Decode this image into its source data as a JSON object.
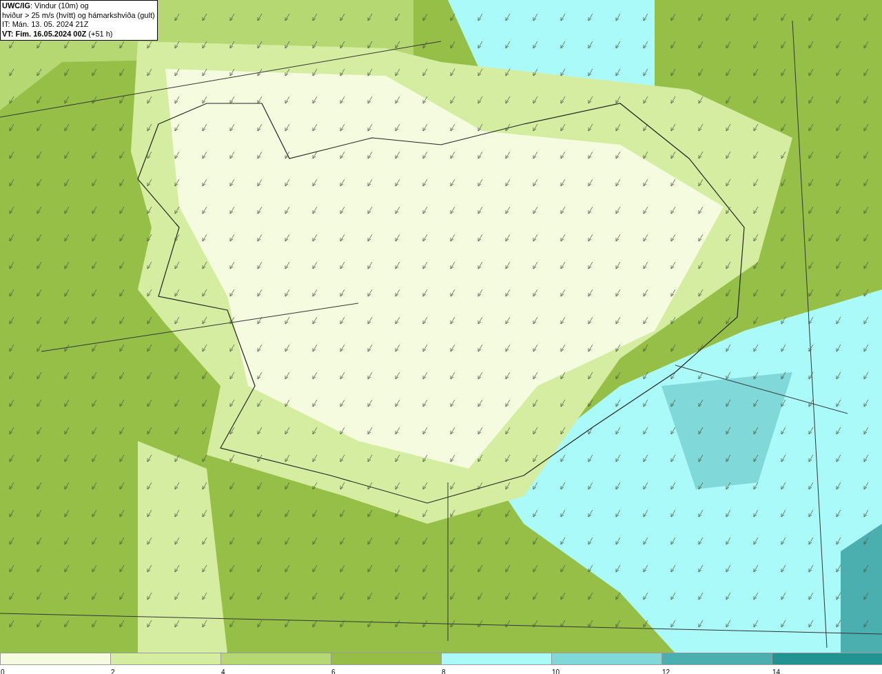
{
  "header": {
    "lines": [
      "**UWC/IG**: Vindur (10m) og",
      "hviður > 25 m/s (hvítt) og hámarkshviða (gult)",
      "IT: Mán. 13. 05. 2024 21Z",
      "**VT: Fim. 16.05.2024 00Z** (+51 h)"
    ]
  },
  "legend": {
    "segments": [
      {
        "color": "#f4fbdf"
      },
      {
        "color": "#d5eda0"
      },
      {
        "color": "#b6d873"
      },
      {
        "color": "#96bd46"
      },
      {
        "color": "#abfafa"
      },
      {
        "color": "#81d8d9"
      },
      {
        "color": "#4cafaf"
      },
      {
        "color": "#219391"
      }
    ],
    "ticks": [
      "0",
      "2",
      "4",
      "6",
      "8",
      "10",
      "12",
      "14"
    ]
  }
}
